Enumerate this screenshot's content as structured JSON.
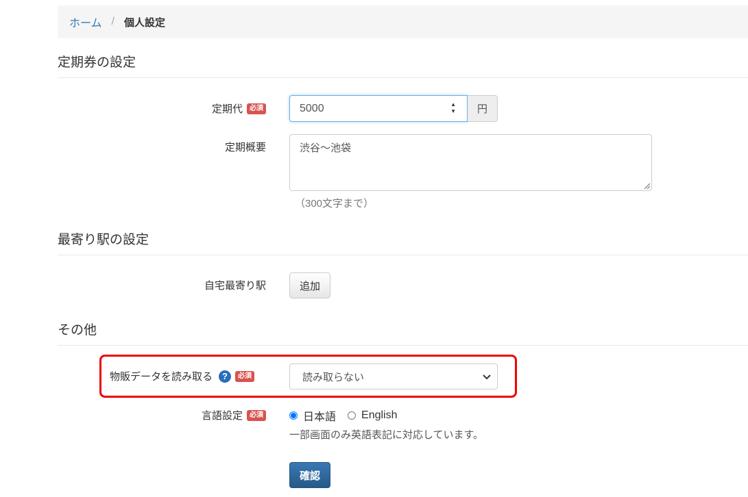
{
  "breadcrumb": {
    "home": "ホーム",
    "separator": "/",
    "current": "個人設定"
  },
  "sections": {
    "commuter": "定期券の設定",
    "station": "最寄り駅の設定",
    "other": "その他"
  },
  "required_badge": "必須",
  "commuter": {
    "fare_label": "定期代",
    "fare_value": "5000",
    "fare_unit": "円",
    "summary_label": "定期概要",
    "summary_value": "渋谷〜池袋",
    "summary_hint": "（300文字まで）"
  },
  "station": {
    "home_label": "自宅最寄り駅",
    "add_button": "追加"
  },
  "other": {
    "product_label": "物販データを読み取る",
    "help_icon": "?",
    "product_value": "読み取らない",
    "language_label": "言語設定",
    "lang_ja": "日本語",
    "lang_en": "English",
    "language_hint": "一部画面のみ英語表記に対応しています。"
  },
  "confirm_button": "確認",
  "colors": {
    "link": "#337ab7",
    "badge": "#d9534f",
    "primary": "#2e6da4",
    "highlight": "#ee0000"
  }
}
